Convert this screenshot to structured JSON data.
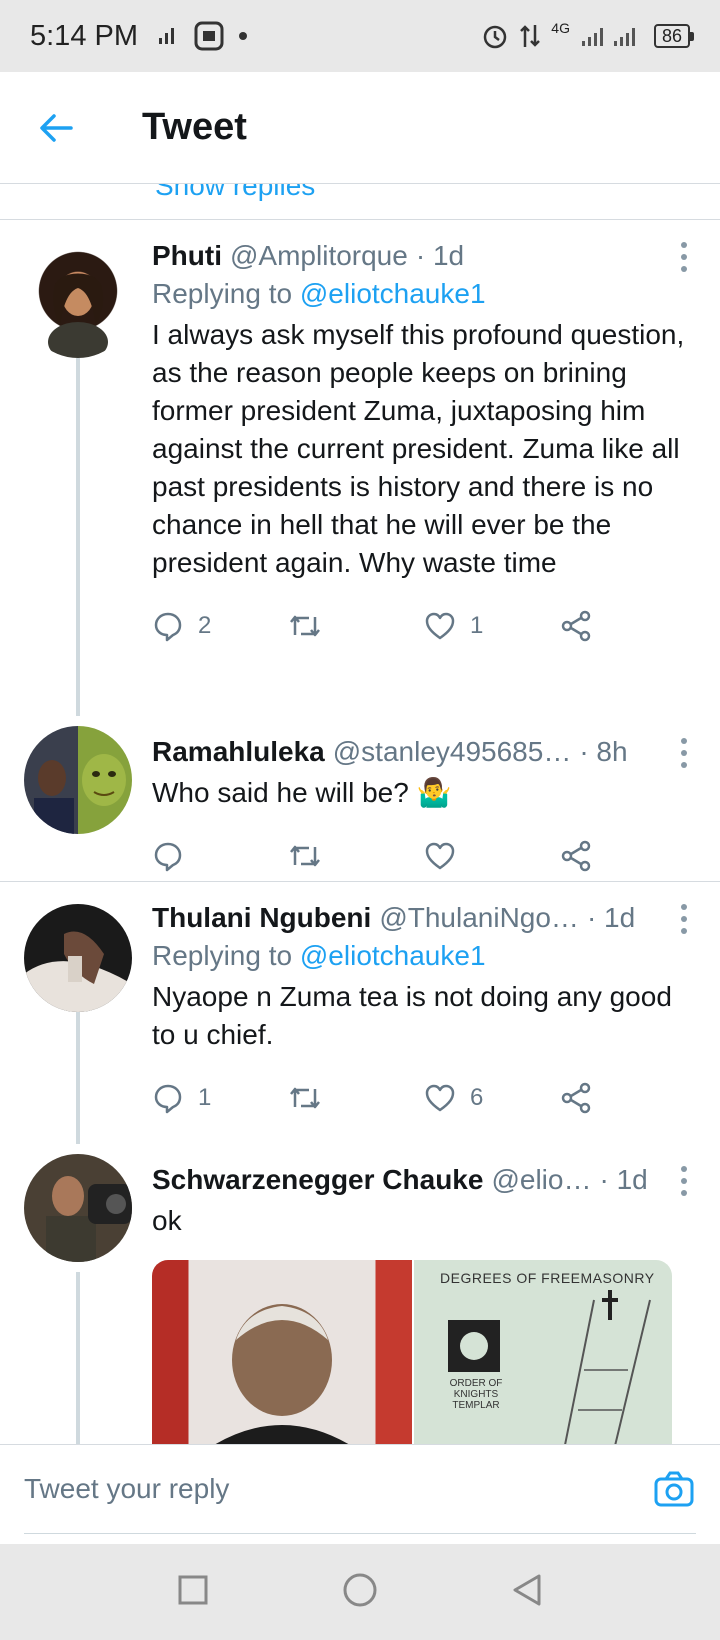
{
  "status_bar": {
    "time": "5:14 PM",
    "network": "4G",
    "battery": "86"
  },
  "header": {
    "title": "Tweet"
  },
  "feed": {
    "cutoff_text": "Show replies",
    "tweets": [
      {
        "name": "Phuti",
        "handle": "@Amplitorque",
        "time": "· 1d",
        "reply_prefix": "Replying to ",
        "reply_mention": "@eliotchauke1",
        "text": "I always ask myself this profound question, as the reason people keeps on brining former president Zuma, juxtaposing him against the current president. Zuma like all past presidents is history and there is no chance in hell that he will ever be the president again. Why waste time",
        "replies": "2",
        "retweets": "",
        "likes": "1"
      },
      {
        "name": "Ramahluleka",
        "handle": "@stanley495685…",
        "time": "· 8h",
        "text": "Who said he will be? 🤷‍♂️",
        "replies": "",
        "retweets": "",
        "likes": ""
      },
      {
        "name": "Thulani Ngubeni",
        "handle": "@ThulaniNgo…",
        "time": "· 1d",
        "reply_prefix": "Replying to ",
        "reply_mention": "@eliotchauke1",
        "text": "Nyaope n Zuma tea is not doing any good to u chief.",
        "replies": "1",
        "retweets": "",
        "likes": "6"
      },
      {
        "name": "Schwarzenegger Chauke",
        "handle": "@elio…",
        "time": "· 1d",
        "text": "ok",
        "media_text": {
          "title": "DEGREES OF FREEMASONRY",
          "label1": "ORDER OF",
          "label2": "KNIGHTS TEMPLAR"
        }
      }
    ]
  },
  "compose": {
    "placeholder": "Tweet your reply"
  }
}
